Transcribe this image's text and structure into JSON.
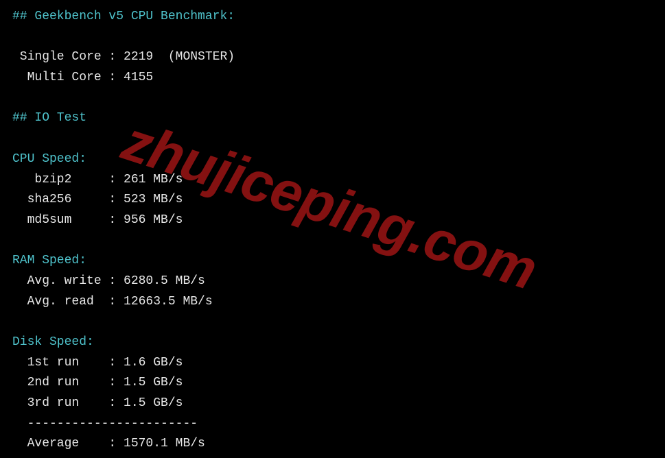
{
  "geekbench": {
    "header": "## Geekbench v5 CPU Benchmark:",
    "single_core_label": " Single Core : ",
    "single_core_value": "2219  (MONSTER)",
    "multi_core_label": "  Multi Core : ",
    "multi_core_value": "4155"
  },
  "io_test": {
    "header": "## IO Test"
  },
  "cpu_speed": {
    "header": "CPU Speed:",
    "bzip2_label": "   bzip2     : ",
    "bzip2_value": "261 MB/s",
    "sha256_label": "  sha256     : ",
    "sha256_value": "523 MB/s",
    "md5sum_label": "  md5sum     : ",
    "md5sum_value": "956 MB/s"
  },
  "ram_speed": {
    "header": "RAM Speed:",
    "write_label": "  Avg. write : ",
    "write_value": "6280.5 MB/s",
    "read_label": "  Avg. read  : ",
    "read_value": "12663.5 MB/s"
  },
  "disk_speed": {
    "header": "Disk Speed:",
    "run1_label": "  1st run    : ",
    "run1_value": "1.6 GB/s",
    "run2_label": "  2nd run    : ",
    "run2_value": "1.5 GB/s",
    "run3_label": "  3rd run    : ",
    "run3_value": "1.5 GB/s",
    "separator": "  -----------------------",
    "average_label": "  Average    : ",
    "average_value": "1570.1 MB/s"
  },
  "watermark": "zhujiceping.com"
}
